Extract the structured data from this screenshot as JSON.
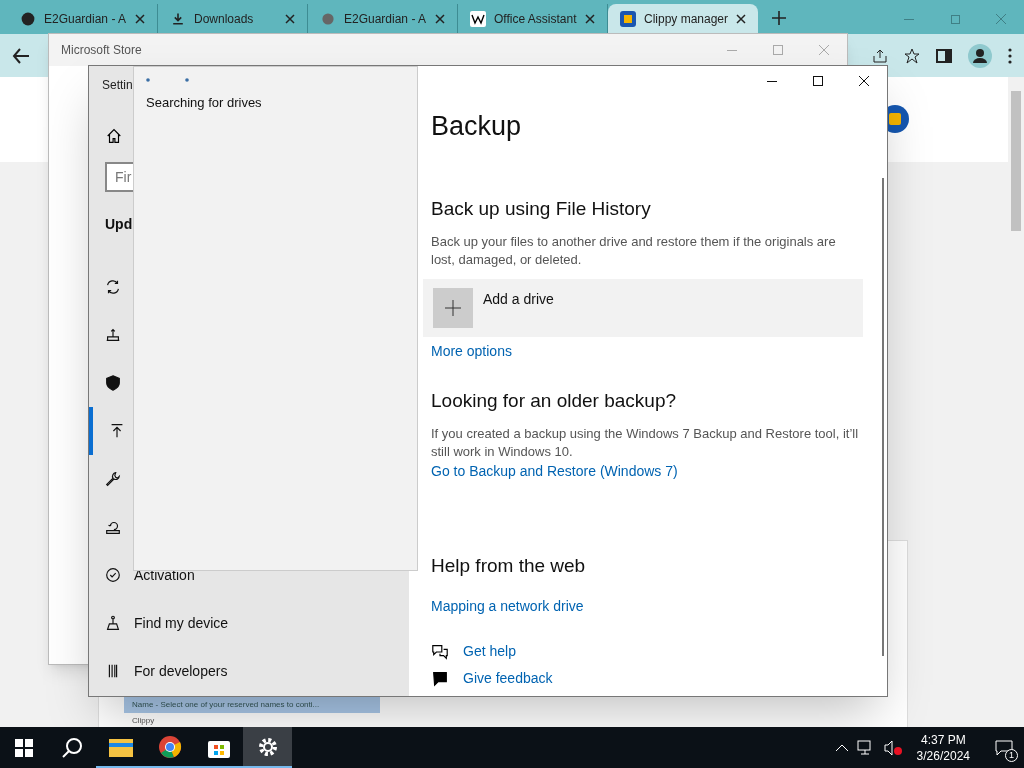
{
  "browser": {
    "tabs": [
      {
        "title": "E2Guardian - A",
        "kind": "github",
        "selected": false
      },
      {
        "title": "Downloads",
        "kind": "download",
        "selected": false
      },
      {
        "title": "E2Guardian - A",
        "kind": "globe",
        "selected": false
      },
      {
        "title": "Office Assistant",
        "kind": "wiki",
        "selected": false
      },
      {
        "title": "Clippy manager",
        "kind": "app",
        "selected": true
      }
    ],
    "page": {
      "list_rows": [
        {
          "text": "Name - Select one of your reserved names to conti...",
          "selected": true
        },
        {
          "text": "Clippy",
          "selected": false
        }
      ]
    }
  },
  "store_window": {
    "title": "Microsoft Store"
  },
  "settings": {
    "title": "Settin",
    "search_placeholder": "Fir",
    "section": "Upd",
    "nav": [
      {
        "kind": "sync",
        "selected": false
      },
      {
        "kind": "delivery",
        "selected": false
      },
      {
        "kind": "shield",
        "selected": false
      },
      {
        "kind": "backup",
        "selected": true
      },
      {
        "kind": "wrench",
        "selected": false
      },
      {
        "kind": "recovery",
        "selected": false
      },
      {
        "kind": "activation",
        "label": "Activation",
        "selected": false
      },
      {
        "kind": "finddevice",
        "label": "Find my device",
        "selected": false
      },
      {
        "kind": "developers",
        "label": "For developers",
        "selected": false
      }
    ],
    "flyout": {
      "text": "Searching for drives"
    },
    "content": {
      "title": "Backup",
      "file_history": {
        "heading": "Back up using File History",
        "description": "Back up your files to another drive and restore them if the originals are lost, damaged, or deleted.",
        "add_button": "Add a drive",
        "link": "More options"
      },
      "older": {
        "heading": "Looking for an older backup?",
        "description": "If you created a backup using the Windows 7 Backup and Restore tool, it’ll still work in Windows 10.",
        "link": "Go to Backup and Restore (Windows 7)"
      },
      "help": {
        "heading": "Help from the web",
        "links": [
          "Mapping a network drive"
        ]
      },
      "footer_links": [
        {
          "kind": "help",
          "text": "Get help"
        },
        {
          "kind": "feedback",
          "text": "Give feedback"
        }
      ]
    }
  },
  "taskbar": {
    "apps": [
      {
        "kind": "explorer",
        "selected": false
      },
      {
        "kind": "chrome",
        "selected": false
      },
      {
        "kind": "store",
        "selected": false
      },
      {
        "kind": "settings",
        "selected": true
      }
    ],
    "time": "4:37 PM",
    "date": "3/26/2024",
    "notifications": "1"
  }
}
